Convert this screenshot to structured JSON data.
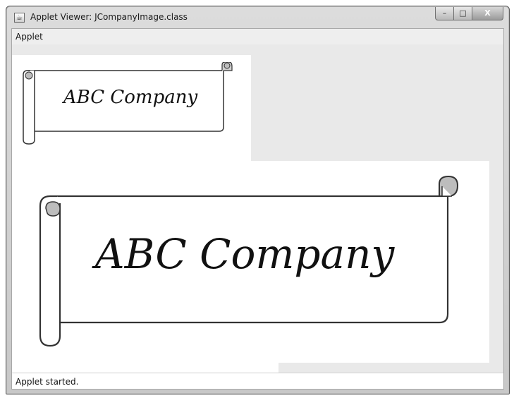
{
  "window": {
    "title": "Applet Viewer: JCompanyImage.class",
    "buttons": {
      "minimize": "–",
      "maximize": "□",
      "close": "X"
    }
  },
  "menubar": {
    "items": [
      "Applet"
    ]
  },
  "applet": {
    "small_scroll_text": "ABC Company",
    "large_scroll_text": "ABC Company"
  },
  "statusbar": {
    "text": "Applet started."
  }
}
